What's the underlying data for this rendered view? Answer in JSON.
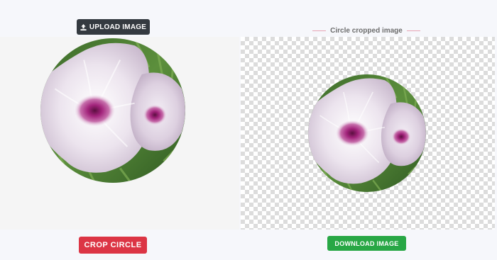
{
  "toolbar": {
    "upload_label": "UPLOAD IMAGE",
    "upload_icon": "upload-icon"
  },
  "preview": {
    "title": "Circle cropped image"
  },
  "actions": {
    "crop_label": "CROP CIRCLE",
    "download_label": "DOWNLOAD IMAGE"
  },
  "colors": {
    "upload_button": "#343a40",
    "crop_button": "#dc3545",
    "download_button": "#28a745",
    "title_rule": "#e7a3b4"
  }
}
